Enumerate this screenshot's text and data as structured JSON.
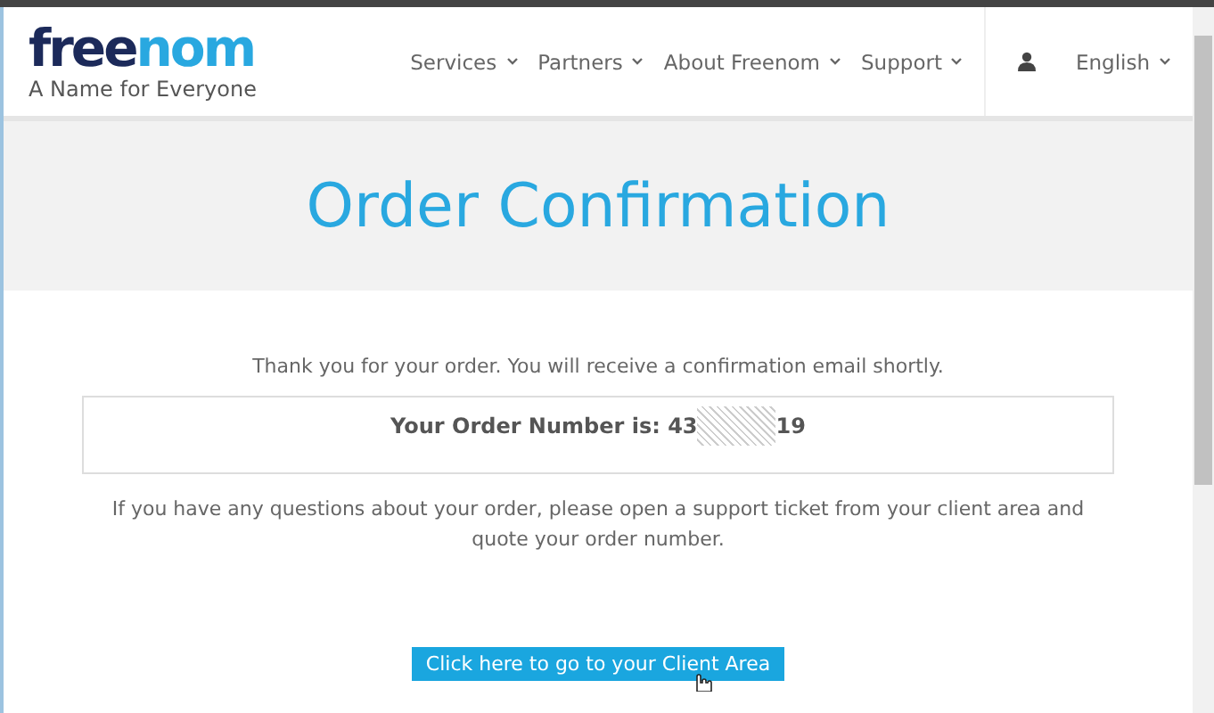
{
  "logo": {
    "part_1": "free",
    "part_2": "nom",
    "tagline": "A Name for Everyone"
  },
  "nav": [
    {
      "label": "Services",
      "dropdown": true
    },
    {
      "label": "Partners",
      "dropdown": true
    },
    {
      "label": "About Freenom",
      "dropdown": true
    },
    {
      "label": "Support",
      "dropdown": true
    }
  ],
  "language": {
    "label": "English",
    "dropdown": true
  },
  "banner": {
    "title": "Order Confirmation"
  },
  "thanks": "Thank you for your order. You will receive a confirmation email shortly.",
  "order_box": {
    "label": "Your Order Number is:",
    "number_start": "43",
    "number_end": "19"
  },
  "note": "If you have any questions about your order, please open a support ticket from your client area and quote your order number.",
  "button": "Click here to go to your Client Area"
}
